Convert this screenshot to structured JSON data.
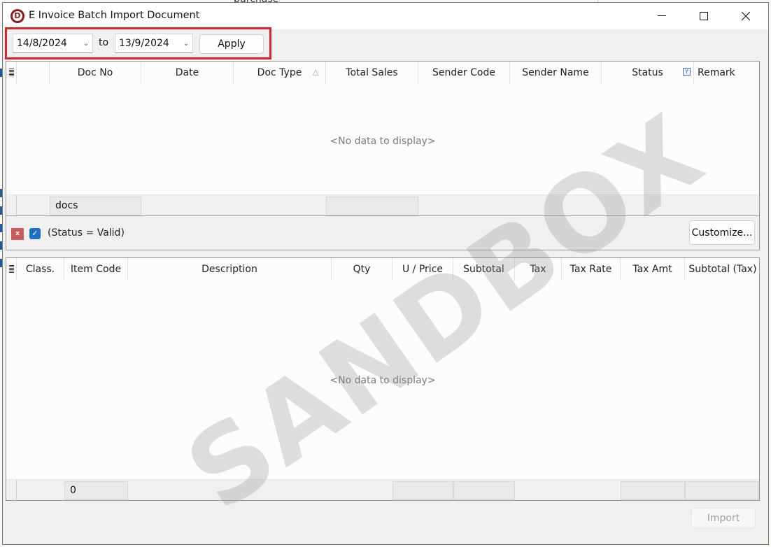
{
  "background": {
    "partial_text": "purchase"
  },
  "window": {
    "title": "E Invoice Batch Import Document",
    "app_icon_letter": "D",
    "controls": {
      "minimize": "—",
      "maximize": "☐",
      "close": "✕"
    }
  },
  "filter_bar": {
    "from_date": "14/8/2024",
    "to_label": "to",
    "to_date": "13/9/2024",
    "apply_label": "Apply",
    "highlight_color": "#e0202a"
  },
  "documents_grid": {
    "columns": [
      "Doc No",
      "Date",
      "Doc Type",
      "Total Sales",
      "Sender Code",
      "Sender Name",
      "Status",
      "Remark"
    ],
    "sorted_column": "Doc Type",
    "filtered_column": "Status",
    "empty_text": "<No data to display>",
    "footer": {
      "doc_no_summary": "docs",
      "total_sales_summary": ""
    }
  },
  "filter_panel": {
    "filter_expression": "(Status = Valid)",
    "filter_enabled": true,
    "clear_label": "x",
    "customize_label": "Customize..."
  },
  "items_grid": {
    "columns": [
      "Class.",
      "Item Code",
      "Description",
      "Qty",
      "U / Price",
      "Subtotal",
      "Tax",
      "Tax Rate",
      "Tax Amt",
      "Subtotal (Tax)"
    ],
    "empty_text": "<No data to display>",
    "footer": {
      "item_code_summary": "0"
    }
  },
  "actions": {
    "import_label": "Import",
    "import_enabled": false
  },
  "watermark": "SANDBOX"
}
